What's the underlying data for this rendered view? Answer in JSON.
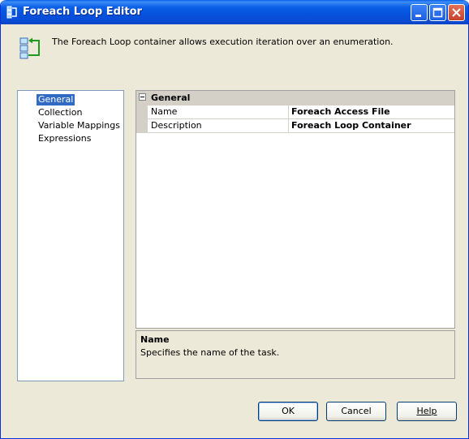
{
  "window": {
    "title": "Foreach Loop Editor",
    "icon": "foreach-container-icon"
  },
  "header": {
    "icon": "foreach-container-icon",
    "text": "The Foreach Loop container allows execution iteration over an enumeration."
  },
  "nav": {
    "items": [
      {
        "label": "General",
        "selected": true
      },
      {
        "label": "Collection",
        "selected": false
      },
      {
        "label": "Variable Mappings",
        "selected": false
      },
      {
        "label": "Expressions",
        "selected": false
      }
    ]
  },
  "grid": {
    "category": "General",
    "rows": [
      {
        "name": "Name",
        "value": "Foreach Access File"
      },
      {
        "name": "Description",
        "value": "Foreach Loop Container"
      }
    ]
  },
  "description": {
    "title": "Name",
    "text": "Specifies the name of the task."
  },
  "buttons": {
    "ok": "OK",
    "cancel": "Cancel",
    "help": "Help"
  },
  "colors": {
    "titlebar": "#0a5ee6",
    "selection": "#316ac5",
    "dialog_bg": "#ece9d8"
  }
}
